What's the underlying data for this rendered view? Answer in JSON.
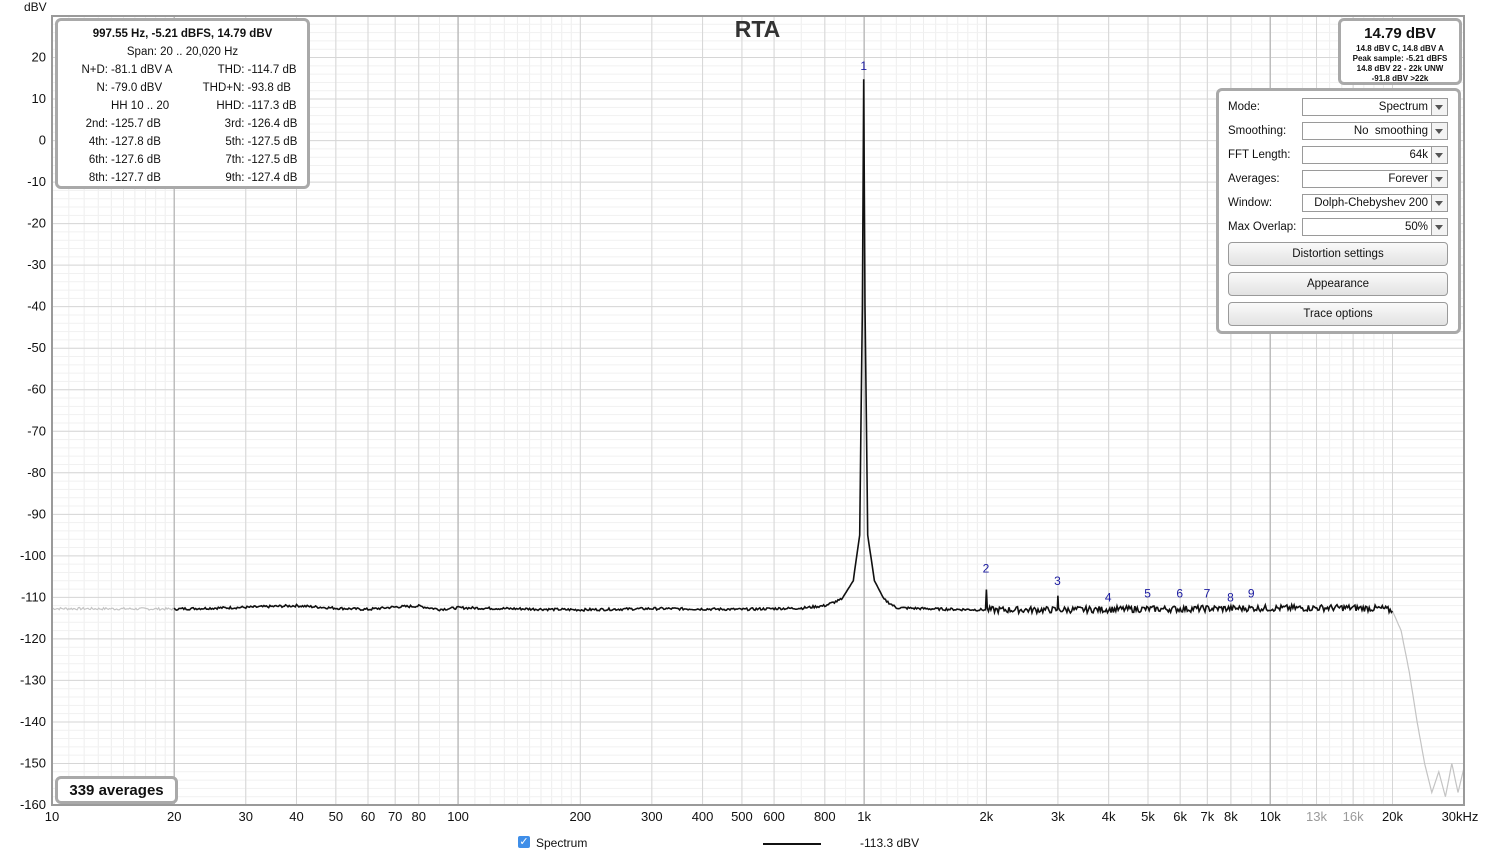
{
  "window": {
    "title": "RTA"
  },
  "chart_data": {
    "type": "line",
    "title": "RTA",
    "ylabel": "dBV",
    "xlabel": "",
    "xscale": "log",
    "xlim": [
      10,
      30000
    ],
    "ylim": [
      -160,
      30
    ],
    "y_ticks": [
      "20",
      "10",
      "0",
      "-10",
      "-20",
      "-30",
      "-40",
      "-50",
      "-60",
      "-70",
      "-80",
      "-90",
      "-100",
      "-110",
      "-120",
      "-130",
      "-140",
      "-150",
      "-160"
    ],
    "x_ticks": [
      {
        "v": 10,
        "label": "10"
      },
      {
        "v": 20,
        "label": "20"
      },
      {
        "v": 30,
        "label": "30"
      },
      {
        "v": 40,
        "label": "40"
      },
      {
        "v": 50,
        "label": "50"
      },
      {
        "v": 60,
        "label": "60"
      },
      {
        "v": 70,
        "label": "70"
      },
      {
        "v": 80,
        "label": "80"
      },
      {
        "v": 100,
        "label": "100"
      },
      {
        "v": 200,
        "label": "200"
      },
      {
        "v": 300,
        "label": "300"
      },
      {
        "v": 400,
        "label": "400"
      },
      {
        "v": 500,
        "label": "500"
      },
      {
        "v": 600,
        "label": "600"
      },
      {
        "v": 800,
        "label": "800"
      },
      {
        "v": 1000,
        "label": "1k"
      },
      {
        "v": 2000,
        "label": "2k"
      },
      {
        "v": 3000,
        "label": "3k"
      },
      {
        "v": 4000,
        "label": "4k"
      },
      {
        "v": 5000,
        "label": "5k"
      },
      {
        "v": 6000,
        "label": "6k"
      },
      {
        "v": 7000,
        "label": "7k"
      },
      {
        "v": 8000,
        "label": "8k"
      },
      {
        "v": 10000,
        "label": "10k"
      },
      {
        "v": 13000,
        "label": "13k",
        "muted": true
      },
      {
        "v": 16000,
        "label": "16k",
        "muted": true
      },
      {
        "v": 20000,
        "label": "20k"
      },
      {
        "v": 30000,
        "label": "30kHz"
      }
    ],
    "series": [
      {
        "name": "Spectrum",
        "color": "#111111",
        "points": [
          [
            20,
            -112.8
          ],
          [
            30,
            -112.4
          ],
          [
            40,
            -112.0
          ],
          [
            50,
            -112.6
          ],
          [
            60,
            -112.9
          ],
          [
            70,
            -112.3
          ],
          [
            80,
            -112.1
          ],
          [
            90,
            -112.9
          ],
          [
            100,
            -112.5
          ],
          [
            150,
            -112.8
          ],
          [
            200,
            -113.0
          ],
          [
            300,
            -112.7
          ],
          [
            400,
            -112.8
          ],
          [
            500,
            -112.9
          ],
          [
            600,
            -112.7
          ],
          [
            700,
            -112.6
          ],
          [
            800,
            -112.0
          ],
          [
            880,
            -110.5
          ],
          [
            940,
            -106.0
          ],
          [
            975,
            -95.0
          ],
          [
            990,
            -40.0
          ],
          [
            997.55,
            14.79
          ],
          [
            1005,
            -40.0
          ],
          [
            1020,
            -95.0
          ],
          [
            1060,
            -106.0
          ],
          [
            1120,
            -110.5
          ],
          [
            1200,
            -112.5
          ],
          [
            1500,
            -112.8
          ],
          [
            1990,
            -113.0
          ],
          [
            2000,
            -108.1
          ],
          [
            2010,
            -113.0
          ],
          [
            2990,
            -113.0
          ],
          [
            3000,
            -109.6
          ],
          [
            3010,
            -113.0
          ],
          [
            4000,
            -112.9
          ],
          [
            5000,
            -112.8
          ],
          [
            6000,
            -112.8
          ],
          [
            7000,
            -112.7
          ],
          [
            8000,
            -112.7
          ],
          [
            9000,
            -112.6
          ],
          [
            10000,
            -112.6
          ],
          [
            15000,
            -112.5
          ],
          [
            19000,
            -112.7
          ],
          [
            20000,
            -113.3
          ]
        ]
      },
      {
        "name": "Out of span",
        "color": "#c4c4c4",
        "points": [
          [
            10,
            -112.7
          ],
          [
            20,
            -112.8
          ]
        ]
      },
      {
        "name": "Out of span",
        "color": "#c4c4c4",
        "points": [
          [
            20000,
            -113.3
          ],
          [
            21000,
            -118
          ],
          [
            22000,
            -128
          ],
          [
            23000,
            -140
          ],
          [
            24000,
            -150
          ],
          [
            25000,
            -157
          ],
          [
            26000,
            -152
          ],
          [
            27000,
            -158
          ],
          [
            28000,
            -150
          ],
          [
            29000,
            -157
          ],
          [
            30000,
            -151
          ]
        ]
      }
    ],
    "harmonic_markers": [
      {
        "label": "1",
        "f": 997.55,
        "db": 17
      },
      {
        "label": "2",
        "f": 1995,
        "db": -104
      },
      {
        "label": "3",
        "f": 2993,
        "db": -107
      },
      {
        "label": "4",
        "f": 3990,
        "db": -111
      },
      {
        "label": "5",
        "f": 4988,
        "db": -110
      },
      {
        "label": "6",
        "f": 5985,
        "db": -110
      },
      {
        "label": "7",
        "f": 6983,
        "db": -110
      },
      {
        "label": "8",
        "f": 7980,
        "db": -111
      },
      {
        "label": "9",
        "f": 8978,
        "db": -110
      }
    ],
    "grid": true
  },
  "distortion": {
    "header": "997.55 Hz, -5.21 dBFS, 14.79 dBV",
    "span": "Span: 20 .. 20,020 Hz",
    "rows": [
      {
        "l1": "N+D:",
        "v1": "-81.1 dBV A",
        "l2": "THD:",
        "v2": "-114.7 dB"
      },
      {
        "l1": "N:",
        "v1": "-79.0 dBV",
        "l2": "THD+N:",
        "v2": "-93.8 dB"
      },
      {
        "l1": "",
        "v1": "HH 10 .. 20",
        "l2": "HHD:",
        "v2": "-117.3 dB"
      },
      {
        "l1": "2nd:",
        "v1": "-125.7 dB",
        "l2": "3rd:",
        "v2": "-126.4 dB"
      },
      {
        "l1": "4th:",
        "v1": "-127.8 dB",
        "l2": "5th:",
        "v2": "-127.5 dB"
      },
      {
        "l1": "6th:",
        "v1": "-127.6 dB",
        "l2": "7th:",
        "v2": "-127.5 dB"
      },
      {
        "l1": "8th:",
        "v1": "-127.7 dB",
        "l2": "9th:",
        "v2": "-127.4 dB"
      }
    ]
  },
  "level": {
    "main": "14.79 dBV",
    "line1": "14.8 dBV C, 14.8 dBV A",
    "line2": "Peak sample: -5.21 dBFS",
    "line3": "14.8 dBV 22 - 22k UNW",
    "line4": "-91.8 dBV >22k"
  },
  "controls": {
    "mode": {
      "label": "Mode:",
      "value": "Spectrum"
    },
    "smoothing": {
      "label": "Smoothing:",
      "value": "No  smoothing"
    },
    "fft": {
      "label": "FFT Length:",
      "value": "64k"
    },
    "averages": {
      "label": "Averages:",
      "value": "Forever"
    },
    "window": {
      "label": "Window:",
      "value": "Dolph-Chebyshev 200"
    },
    "overlap": {
      "label": "Max Overlap:",
      "value": "50%"
    },
    "distortion_btn": "Distortion settings",
    "appearance_btn": "Appearance",
    "trace_btn": "Trace options"
  },
  "averages_badge": "339 averages",
  "legend": {
    "name": "Spectrum",
    "value": "-113.3 dBV",
    "checked": "✓"
  }
}
